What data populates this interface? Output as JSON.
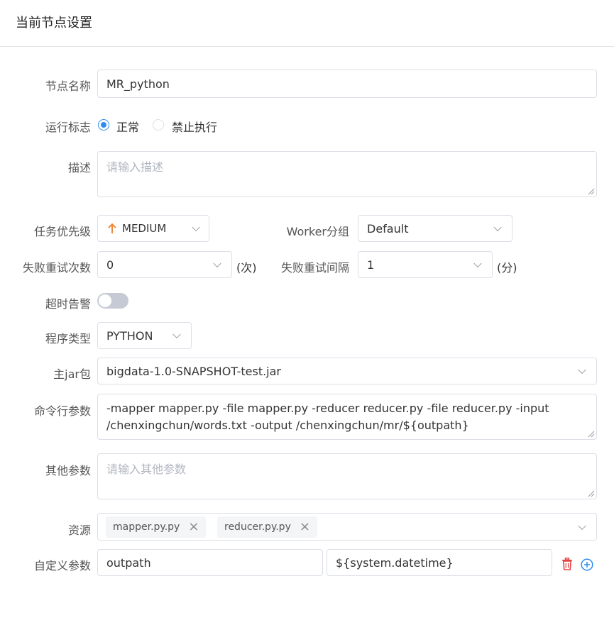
{
  "header": {
    "title": "当前节点设置"
  },
  "node_name": {
    "label": "节点名称",
    "value": "MR_python"
  },
  "run_flag": {
    "label": "运行标志",
    "option_normal": "正常",
    "option_forbid": "禁止执行",
    "selected": "正常"
  },
  "description": {
    "label": "描述",
    "placeholder": "请输入描述"
  },
  "priority": {
    "label": "任务优先级",
    "value": "MEDIUM",
    "icon": "arrow-up-icon",
    "icon_color": "#f0883a"
  },
  "worker_group": {
    "label": "Worker分组",
    "value": "Default"
  },
  "retry_times": {
    "label": "失败重试次数",
    "value": "0",
    "unit": "(次)"
  },
  "retry_interval": {
    "label": "失败重试间隔",
    "value": "1",
    "unit": "(分)"
  },
  "timeout_alarm": {
    "label": "超时告警",
    "enabled": false
  },
  "program_type": {
    "label": "程序类型",
    "value": "PYTHON"
  },
  "main_jar": {
    "label": "主jar包",
    "value": "bigdata-1.0-SNAPSHOT-test.jar"
  },
  "command_args": {
    "label": "命令行参数",
    "line1": "-mapper mapper.py -file mapper.py -reducer reducer.py -file reducer.py -input",
    "line2": "/chenxingchun/words.txt -output /chenxingchun/mr/${outpath}"
  },
  "other_args": {
    "label": "其他参数",
    "placeholder": "请输入其他参数"
  },
  "resources": {
    "label": "资源",
    "tags": [
      "mapper.py.py",
      "reducer.py.py"
    ]
  },
  "custom_params": {
    "label": "自定义参数",
    "key": "outpath",
    "value": "${system.datetime}"
  },
  "colors": {
    "primary": "#2d8cf0",
    "danger": "#e54545",
    "border": "#dcdfe6"
  }
}
